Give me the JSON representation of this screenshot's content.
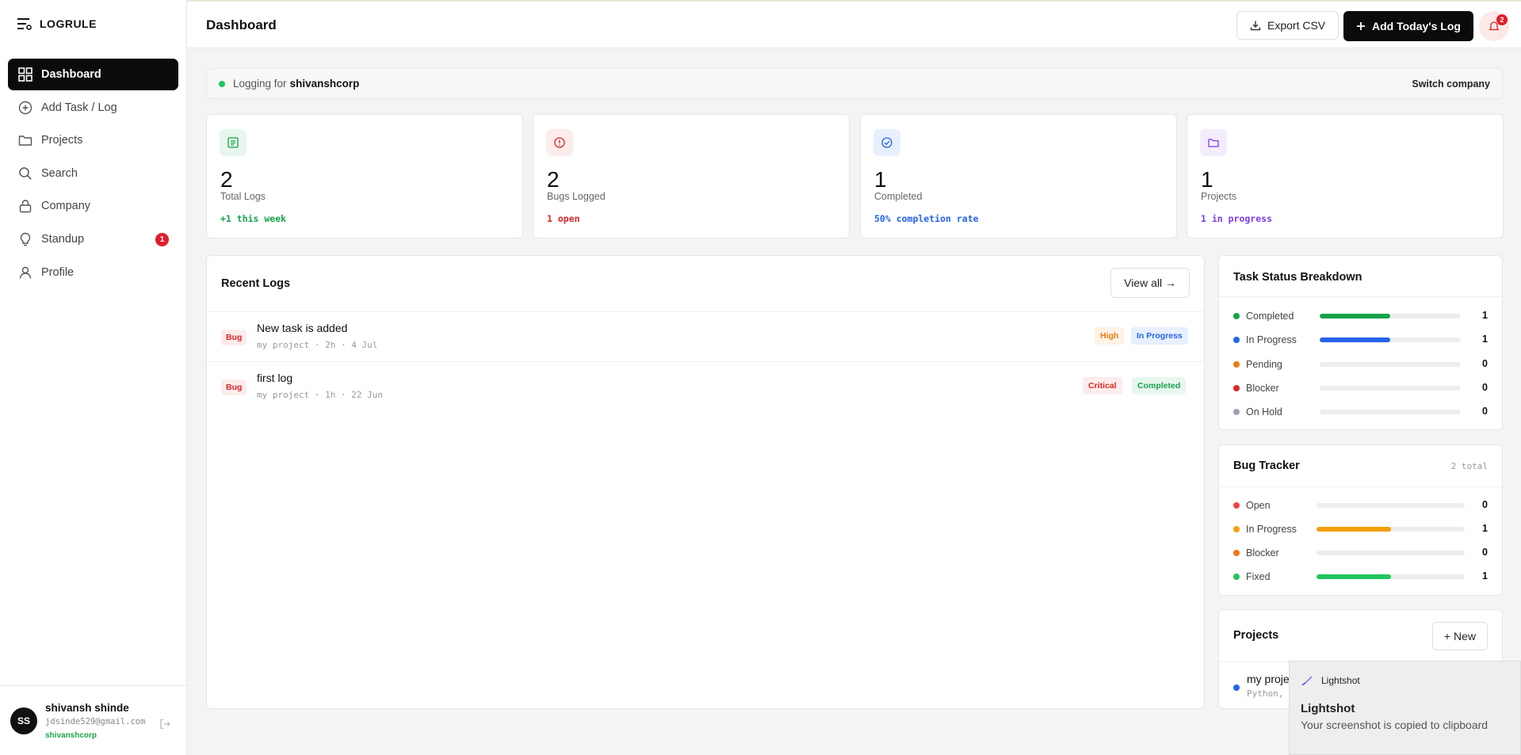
{
  "brand": {
    "name": "LOGRULE"
  },
  "sidebar": {
    "items": [
      {
        "label": "Dashboard",
        "icon": "grid-icon"
      },
      {
        "label": "Add Task / Log",
        "icon": "plus-circle-icon"
      },
      {
        "label": "Projects",
        "icon": "folder-icon"
      },
      {
        "label": "Search",
        "icon": "search-icon"
      },
      {
        "label": "Company",
        "icon": "lock-icon"
      },
      {
        "label": "Standup",
        "icon": "bulb-icon",
        "badge": "1"
      },
      {
        "label": "Profile",
        "icon": "user-icon"
      }
    ],
    "user": {
      "initials": "SS",
      "name": "shivansh shinde",
      "email": "jdsinde529@gmail.com",
      "company": "shivanshcorp"
    }
  },
  "header": {
    "title": "Dashboard",
    "export_label": "Export CSV",
    "add_log_label": "Add Today's Log",
    "notification_count": "2"
  },
  "company_bar": {
    "prefix": "Logging for",
    "company": "shivanshcorp",
    "switch_label": "Switch company"
  },
  "stats": [
    {
      "value": "2",
      "label": "Total Logs",
      "sub": "+1 this week",
      "color": "#16a34a",
      "icon": "document-icon"
    },
    {
      "value": "2",
      "label": "Bugs Logged",
      "sub": "1 open",
      "color": "#dc2626",
      "icon": "alert-icon"
    },
    {
      "value": "1",
      "label": "Completed",
      "sub": "50% completion rate",
      "color": "#2563eb",
      "icon": "check-circle-icon"
    },
    {
      "value": "1",
      "label": "Projects",
      "sub": "1 in progress",
      "color": "#7c3aed",
      "icon": "folder-icon"
    }
  ],
  "recent_logs": {
    "title": "Recent Logs",
    "view_all_label": "View all →",
    "rows": [
      {
        "type": "Bug",
        "title": "New task is added",
        "meta": "my project · 2h · 4 Jul",
        "priority": "High",
        "status": "In Progress"
      },
      {
        "type": "Bug",
        "title": "first log",
        "meta": "my project · 1h · 22 Jun",
        "priority": "Critical",
        "status": "Completed"
      }
    ]
  },
  "task_status": {
    "title": "Task Status Breakdown",
    "rows": [
      {
        "label": "Completed",
        "count": "1",
        "fraction": 0.5,
        "color": "#16a34a"
      },
      {
        "label": "In Progress",
        "count": "1",
        "fraction": 0.5,
        "color": "#2563eb"
      },
      {
        "label": "Pending",
        "count": "0",
        "fraction": 0,
        "color": "#ea7a12"
      },
      {
        "label": "Blocker",
        "count": "0",
        "fraction": 0,
        "color": "#dc2626"
      },
      {
        "label": "On Hold",
        "count": "0",
        "fraction": 0,
        "color": "#9ca3af"
      }
    ]
  },
  "bug_tracker": {
    "title": "Bug Tracker",
    "total": "2 total",
    "rows": [
      {
        "label": "Open",
        "count": "0",
        "fraction": 0,
        "color": "#ef4444"
      },
      {
        "label": "In Progress",
        "count": "1",
        "fraction": 0.5,
        "color": "#f59e0b"
      },
      {
        "label": "Blocker",
        "count": "0",
        "fraction": 0,
        "color": "#f97316"
      },
      {
        "label": "Fixed",
        "count": "1",
        "fraction": 0.5,
        "color": "#22c55e"
      }
    ]
  },
  "projects_panel": {
    "title": "Projects",
    "new_label": "+ New",
    "item_name": "my proje",
    "item_tech": "Python,"
  },
  "toast": {
    "app": "Lightshot",
    "title": "Lightshot",
    "message": "Your screenshot is copied to clipboard"
  }
}
